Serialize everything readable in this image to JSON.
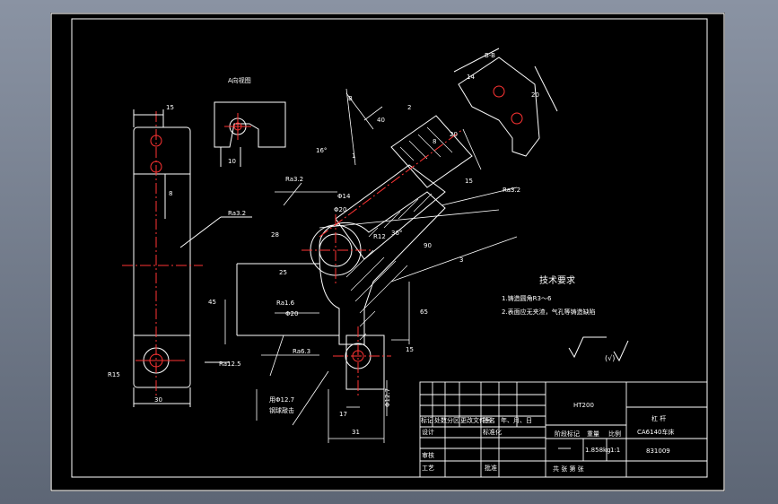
{
  "view_labels": {
    "section_bb": "B-B",
    "letter_b": "B",
    "detail": "A向视图"
  },
  "dimensions": {
    "d15_top": "15",
    "d8": "8",
    "d15_bottom": "R15",
    "d30": "30",
    "d10": "10",
    "d16deg": "16°",
    "d1": "1",
    "d36deg": "36°",
    "d15_arm": "15",
    "d45": "45",
    "d17": "17",
    "d31": "31",
    "d15_right": "15",
    "d2": "2",
    "d8_small": "8",
    "d28": "28",
    "d25": "25",
    "d90": "90",
    "d65": "65",
    "d20_top": "20",
    "d3": "3",
    "d12": "R12",
    "phi20": "Φ20",
    "phi14": "Φ14",
    "phi12": "Φ12.7",
    "d40": "40",
    "d20_view": "20",
    "d14": "14",
    "d21": "21"
  },
  "roughness": {
    "r1": "Ra3.2",
    "r2": "Ra3.2",
    "r3": "Ra3.2",
    "r4": "Ra1.6",
    "r5": "Ra6.3",
    "r6": "Ra12.5"
  },
  "notes": {
    "tech_title": "技术要求",
    "line1": "1.铸造圆角R3～6",
    "line2": "2.表面应无夹渣，气孔等铸造缺陷",
    "pin_note_1": "用Φ12.7",
    "pin_note_2": "钢球敲击",
    "rough_symbol": "(√)"
  },
  "title_block": {
    "material": "HT200",
    "part_name": "杠 杆",
    "machine": "CA6140车床",
    "drawing_no": "831009",
    "headers": [
      "标记",
      "处数",
      "分区",
      "更改文件号",
      "签名",
      "年、月、日"
    ],
    "row_design": "设计",
    "row_std": "标准化",
    "row_stage": "阶段标记",
    "row_weight": "重量",
    "row_scale": "比例",
    "weight_value": "1.858kg",
    "scale_value": "1:1",
    "row_review": "审核",
    "row_process": "工艺",
    "row_approve": "批准",
    "sheets": "共  张  第  张"
  }
}
